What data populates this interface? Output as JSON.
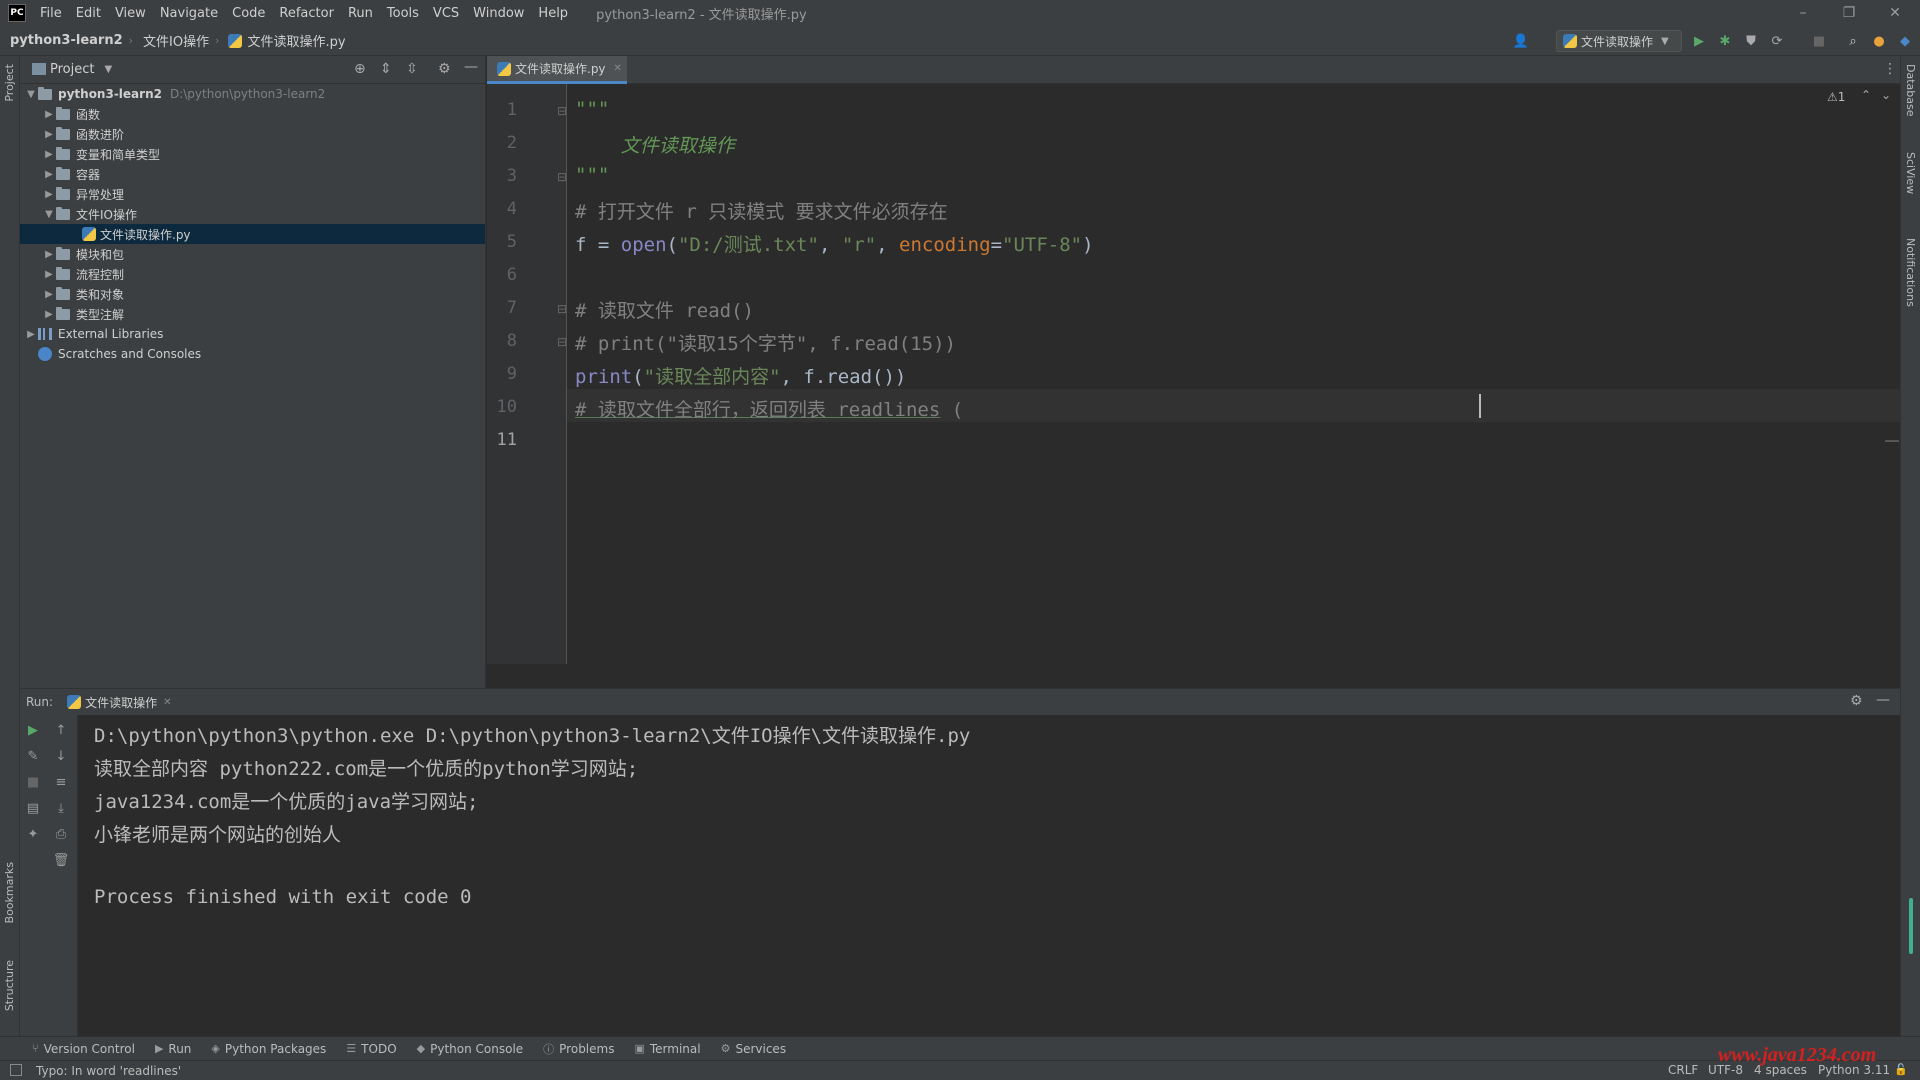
{
  "menubar": {
    "logo": "PC",
    "items": [
      "File",
      "Edit",
      "View",
      "Navigate",
      "Code",
      "Refactor",
      "Run",
      "Tools",
      "VCS",
      "Window",
      "Help"
    ],
    "title": "python3-learn2 - 文件读取操作.py"
  },
  "navbar": {
    "project": "python3-learn2",
    "folder": "文件IO操作",
    "file": "文件读取操作.py",
    "run_config": "文件读取操作"
  },
  "left_strip": {
    "project": "Project",
    "bookmarks": "Bookmarks",
    "structure": "Structure"
  },
  "right_strip": {
    "database": "Database",
    "sciview": "SciView",
    "notifications": "Notifications"
  },
  "project_panel": {
    "title": "Project",
    "root": {
      "name": "python3-learn2",
      "path": "D:\\python\\python3-learn2"
    },
    "folders": [
      "函数",
      "函数进阶",
      "变量和简单类型",
      "容器",
      "异常处理",
      "文件IO操作"
    ],
    "open_file": "文件读取操作.py",
    "folders_after": [
      "模块和包",
      "流程控制",
      "类和对象",
      "类型注解"
    ],
    "external": "External Libraries",
    "scratches": "Scratches and Consoles"
  },
  "editor": {
    "tab": "文件读取操作.py",
    "warning": "⚠1",
    "line_numbers": [
      "1",
      "2",
      "3",
      "4",
      "5",
      "6",
      "7",
      "8",
      "9",
      "10",
      "11"
    ],
    "lines": {
      "l1": "\"\"\"",
      "l2": "    文件读取操作",
      "l3": "\"\"\"",
      "l4": "# 打开文件 r 只读模式 要求文件必须存在",
      "l5_var": "f = ",
      "l5_fn": "open",
      "l5_p1": "(",
      "l5_s1": "\"D:/测试.txt\"",
      "l5_p2": ", ",
      "l5_s2": "\"r\"",
      "l5_p3": ", ",
      "l5_kw": "encoding",
      "l5_p4": "=",
      "l5_s3": "\"UTF-8\"",
      "l5_p5": ")",
      "l7": "# 读取文件 read()",
      "l8": "# print(\"读取15个字节\", f.read(15))",
      "l9_fn": "print",
      "l9_p1": "(",
      "l9_s1": "\"读取全部内容\"",
      "l9_p2": ", f.read())",
      "l11_a": "# 读取文件全部行，返回列表 ",
      "l11_b": "readlines",
      "l11_c": " ("
    }
  },
  "run_panel": {
    "label": "Run:",
    "tab": "文件读取操作",
    "output": [
      "D:\\python\\python3\\python.exe D:\\python\\python3-learn2\\文件IO操作\\文件读取操作.py",
      "读取全部内容 python222.com是一个优质的python学习网站;",
      "java1234.com是一个优质的java学习网站;",
      "小锋老师是两个网站的创始人",
      "",
      "Process finished with exit code 0"
    ]
  },
  "bottom_bar": [
    "Version Control",
    "Run",
    "Python Packages",
    "TODO",
    "Python Console",
    "Problems",
    "Terminal",
    "Services"
  ],
  "status_bar": {
    "message": "Typo: In word 'readlines'",
    "line_sep": "CRLF",
    "encoding": "UTF-8",
    "indent": "4 spaces",
    "interpreter": "Python 3.11",
    "watermark": "www.java1234.com"
  }
}
